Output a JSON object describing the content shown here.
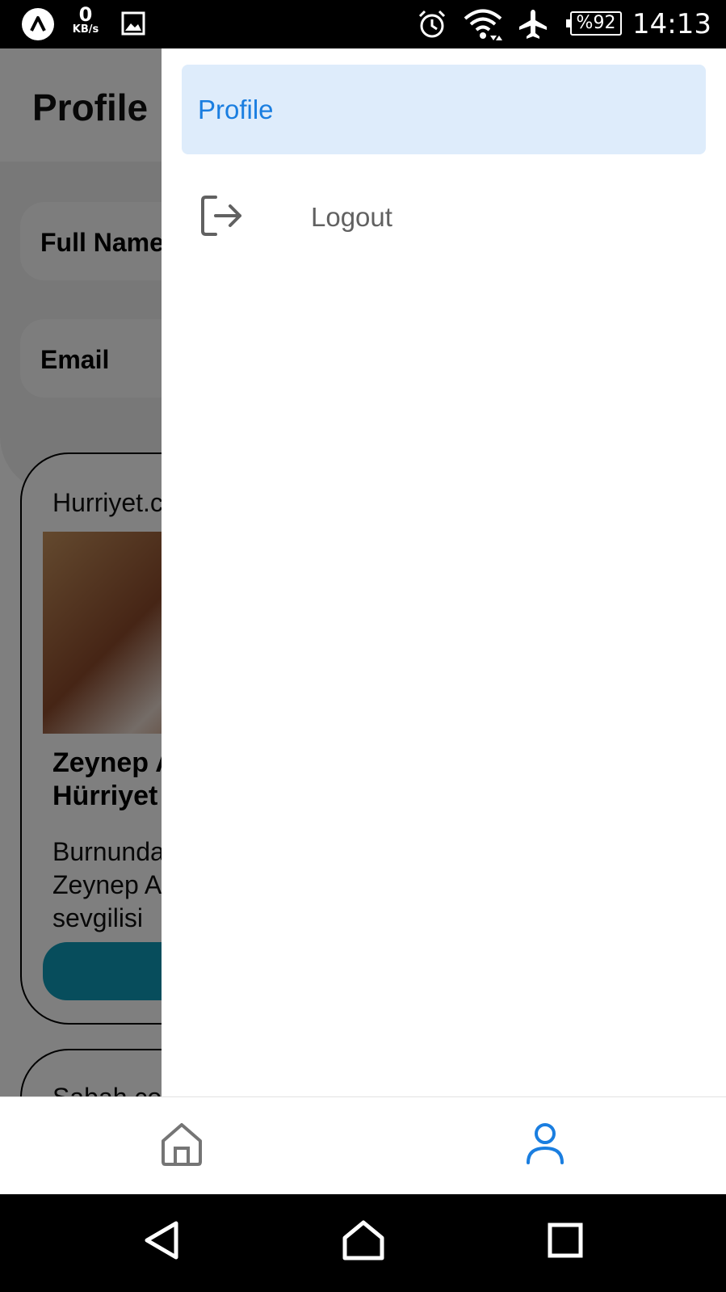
{
  "status_bar": {
    "network_speed_value": "0",
    "network_speed_unit": "KB/s",
    "battery": "%92",
    "time": "14:13",
    "icons": [
      "app-badge-icon",
      "image-icon",
      "alarm-icon",
      "wifi-icon",
      "airplane-mode-icon",
      "battery-icon"
    ]
  },
  "background": {
    "app_bar_title": "Profile",
    "fields": {
      "full_name_label": "Full Name",
      "email_label": "Email"
    },
    "card": {
      "source": "Hurriyet.c",
      "title": "Zeynep A\nHürriyet",
      "description": "Burnunda\nZeynep A\nsevgilisi"
    },
    "card2": {
      "source": "Sabah.co"
    }
  },
  "drawer": {
    "items": [
      {
        "label": "Profile",
        "active": true
      },
      {
        "label": "Logout",
        "icon": "logout-icon",
        "active": false
      }
    ]
  },
  "bottom_nav": {
    "items": [
      {
        "icon": "home-icon",
        "active": false
      },
      {
        "icon": "person-icon",
        "active": true
      }
    ]
  },
  "colors": {
    "accent": "#1a7ee0",
    "drawer_active_bg": "#deecfb",
    "inactive": "#757575",
    "card_button": "#0f9bb8"
  }
}
